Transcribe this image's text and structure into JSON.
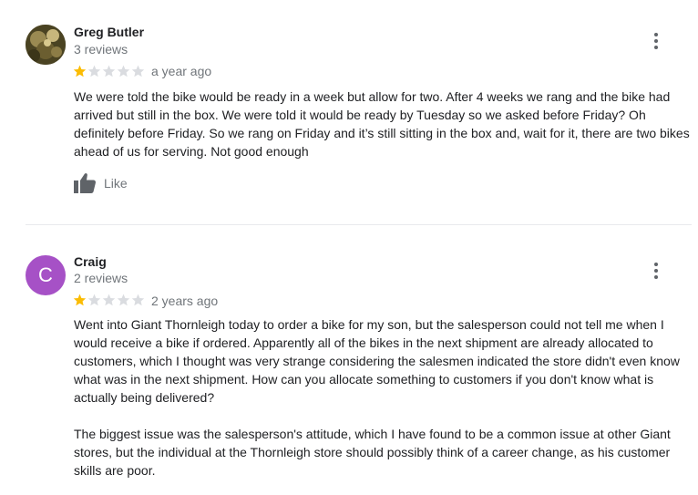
{
  "colors": {
    "star_filled": "#fbbc04",
    "star_empty": "#dadce0",
    "avatar_craig": "#a651c6",
    "secondary_text": "#70757a"
  },
  "reviews": [
    {
      "author": "Greg Butler",
      "review_count": "3 reviews",
      "avatar": "photo",
      "rating": 1,
      "rating_max": 5,
      "time": "a year ago",
      "paragraphs": [
        "We were told the bike would be ready in a week but allow for two. After 4 weeks we rang and the bike had arrived but still in the box. We were told it would be ready by Tuesday so we asked before Friday? Oh definitely before Friday. So we rang on Friday and it’s still sitting in the box and, wait for it, there are two bikes ahead of us for serving. Not good enough"
      ],
      "like_label": "Like",
      "menu_icon": "more-vert-icon"
    },
    {
      "author": "Craig",
      "review_count": "2 reviews",
      "avatar_letter": "C",
      "rating": 1,
      "rating_max": 5,
      "time": "2 years ago",
      "paragraphs": [
        "Went into Giant Thornleigh today to order a bike for my son, but the salesperson could not tell me when I would receive a bike if ordered. Apparently all of the bikes in the next shipment are already allocated to customers, which I thought was very strange considering the salesmen indicated the store didn't even know what was in the next shipment. How can you allocate something to customers if you don't know what is actually being delivered?",
        "The biggest issue was the salesperson's attitude, which I have found to be a common issue at other Giant stores, but the individual at the Thornleigh store should possibly think of a career change, as his customer skills are poor."
      ],
      "menu_icon": "more-vert-icon"
    }
  ]
}
